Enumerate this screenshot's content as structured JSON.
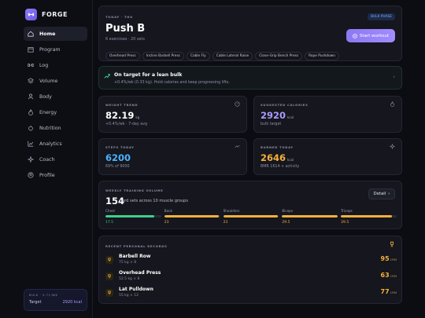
{
  "brand": {
    "name": "FORGE"
  },
  "nav": [
    {
      "label": "Home",
      "icon": "home-icon",
      "active": true
    },
    {
      "label": "Program",
      "icon": "calendar-icon"
    },
    {
      "label": "Log",
      "icon": "dumbbell-icon"
    },
    {
      "label": "Volume",
      "icon": "layers-icon"
    },
    {
      "label": "Body",
      "icon": "user-icon"
    },
    {
      "label": "Energy",
      "icon": "flame-icon"
    },
    {
      "label": "Nutrition",
      "icon": "apple-icon"
    },
    {
      "label": "Analytics",
      "icon": "chart-icon"
    },
    {
      "label": "Coach",
      "icon": "sparkle-icon"
    },
    {
      "label": "Profile",
      "icon": "profile-icon"
    }
  ],
  "bulk": {
    "label": "BULK · 5.71/WK",
    "target_key": "Target",
    "target_value": "2920 kcal"
  },
  "hero": {
    "label": "TODAY · THU",
    "badge": "BULK PHASE",
    "title": "Push B",
    "subtitle": "6 exercises · 20 sets",
    "start_label": "Start workout",
    "chips": [
      "Overhead Press",
      "Incline Barbell Press",
      "Cable Fly",
      "Cable Lateral Raise",
      "Close-Grip Bench Press",
      "Rope Pushdown"
    ]
  },
  "target": {
    "title": "On target for a lean bulk",
    "subtitle": "+0.4%/wk (0.33 kg). Hold calories and keep progressing lifts."
  },
  "stats": {
    "weight": {
      "label": "WEIGHT TREND",
      "value": "82.19",
      "unit": "kg",
      "sub": "+0.4%/wk · 7-day avg",
      "color": "#ffffff"
    },
    "calories": {
      "label": "SUGGESTED CALORIES",
      "value": "2920",
      "unit": "kcal",
      "sub": "bulk target",
      "color": "#a99bff"
    },
    "steps": {
      "label": "STEPS TODAY",
      "value": "6200",
      "unit": "",
      "sub": "69% of 9000",
      "color": "#4ab2ff"
    },
    "burned": {
      "label": "BURNED TODAY",
      "value": "2646",
      "unit": "kcal",
      "sub": "BMR 1614 + activity",
      "color": "#f5b03b"
    }
  },
  "volume": {
    "label": "WEEKLY TRAINING VOLUME",
    "count": "154",
    "text": "hard sets across 10 muscle groups",
    "detail_label": "Detail",
    "muscles": [
      {
        "name": "Chest",
        "value": "17.5",
        "fill": 0.88,
        "color": "#3ecf8e"
      },
      {
        "name": "Back",
        "value": "23",
        "fill": 0.98,
        "color": "#f5b03b"
      },
      {
        "name": "Shoulders",
        "value": "23",
        "fill": 0.98,
        "color": "#f5b03b"
      },
      {
        "name": "Biceps",
        "value": "29.5",
        "fill": 1.0,
        "color": "#f5b03b"
      },
      {
        "name": "Triceps",
        "value": "29.5",
        "fill": 0.92,
        "color": "#f5b03b"
      }
    ]
  },
  "records": {
    "label": "RECENT PERSONAL RECORDS",
    "unit": "1RM",
    "items": [
      {
        "name": "Barbell Row",
        "sub": "75 kg × 8",
        "value": "95"
      },
      {
        "name": "Overhead Press",
        "sub": "52.5 kg × 8",
        "value": "63"
      },
      {
        "name": "Lat Pulldown",
        "sub": "55 kg × 12",
        "value": "77"
      }
    ]
  }
}
